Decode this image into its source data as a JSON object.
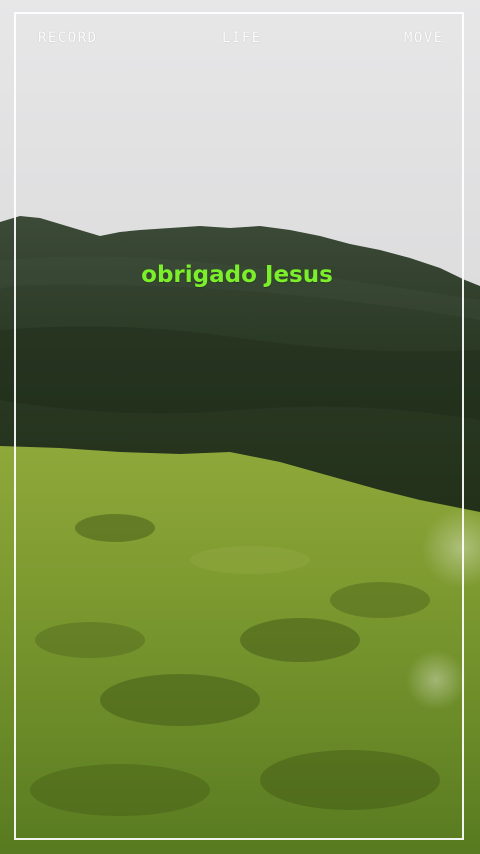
{
  "overlay": {
    "left_label": "RECORD",
    "center_label": "LIFE",
    "right_label": "MOVE"
  },
  "caption": {
    "text": "obrigado Jesus",
    "color": "#7bf02a"
  },
  "colors": {
    "frame": "#ffffff",
    "sky": "#e2e2e3",
    "forest": "#2b3a25",
    "grass": "#7a9a2e"
  }
}
